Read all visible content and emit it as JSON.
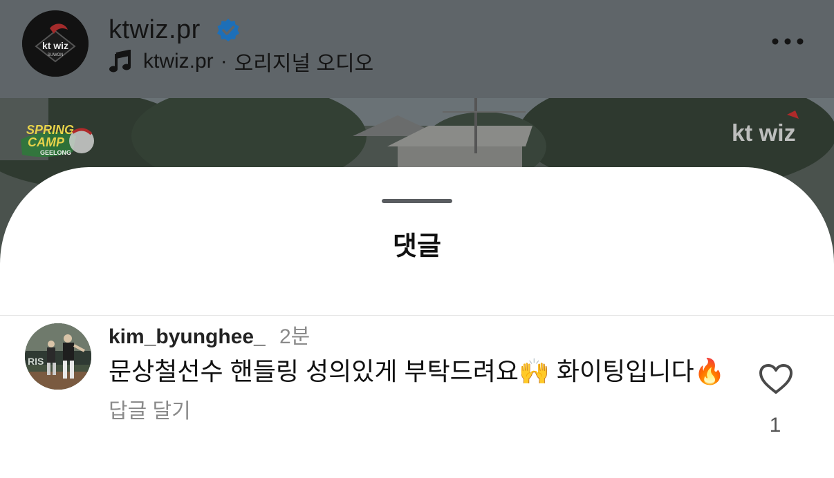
{
  "post": {
    "username": "ktwiz.pr",
    "audio_user": "ktwiz.pr",
    "audio_separator": "·",
    "audio_label": "오리지널 오디오",
    "logo_text": "kt wiz",
    "logo_subtext": "SUWON",
    "media_badge_left_line1": "SPRING",
    "media_badge_left_line2": "CAMP",
    "media_badge_left_line3": "GEELONG",
    "media_watermark": "kt wiz"
  },
  "sheet": {
    "title": "댓글"
  },
  "comment": {
    "username": "kim_byunghee_",
    "time": "2분",
    "text": "문상철선수 핸들링 성의있게 부탁드려요🙌 화이팅입니다🔥",
    "reply_label": "답글 달기",
    "like_count": "1"
  },
  "colors": {
    "header_dim": "#5f6569",
    "verified_blue": "#1d6fb8",
    "sheet_bg": "#ffffff",
    "muted_text": "#8a8a8a"
  }
}
